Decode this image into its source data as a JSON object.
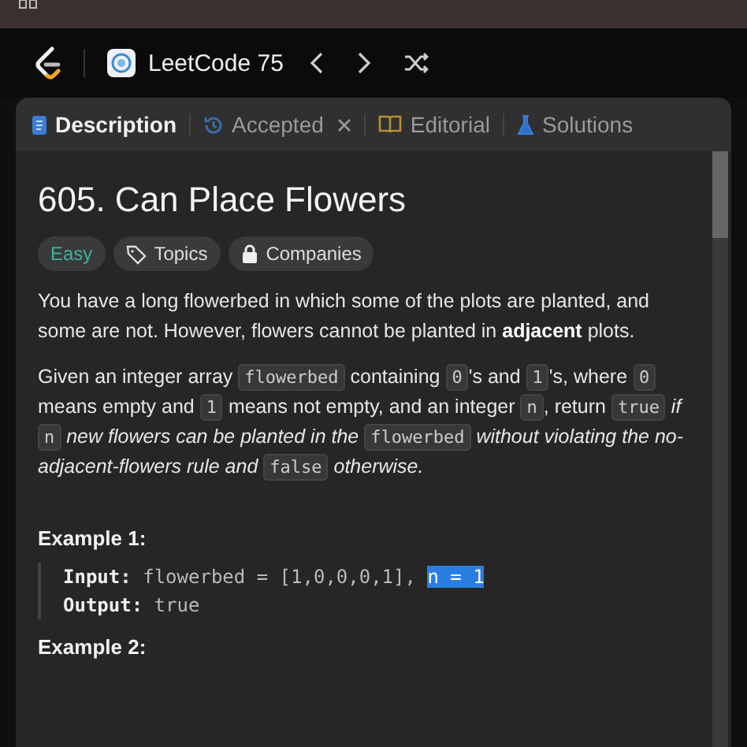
{
  "nav": {
    "list_title": "LeetCode 75"
  },
  "tabs": [
    {
      "label": "Description",
      "selected": true,
      "kind": "doc",
      "closable": false
    },
    {
      "label": "Accepted",
      "selected": false,
      "kind": "history",
      "closable": true
    },
    {
      "label": "Editorial",
      "selected": false,
      "kind": "book",
      "closable": false
    },
    {
      "label": "Solutions",
      "selected": false,
      "kind": "flask",
      "closable": false
    }
  ],
  "problem": {
    "title": "605. Can Place Flowers",
    "tags": [
      {
        "label": "Easy",
        "kind": "difficulty"
      },
      {
        "label": "Topics",
        "kind": "topics"
      },
      {
        "label": "Companies",
        "kind": "companies"
      }
    ],
    "paragraph_1": "You have a long flowerbed in which some of the plots are planted, and some are not. However, flowers cannot be planted in **adjacent** plots.",
    "paragraph_2": [
      {
        "text": "Given an integer array ",
        "kind": "text"
      },
      {
        "text": "flowerbed",
        "kind": "code"
      },
      {
        "text": " containing ",
        "kind": "text"
      },
      {
        "text": "0",
        "kind": "code"
      },
      {
        "text": "'s and ",
        "kind": "text"
      },
      {
        "text": "1",
        "kind": "code"
      },
      {
        "text": "'s, where ",
        "kind": "text"
      },
      {
        "text": "0",
        "kind": "code"
      },
      {
        "text": " means empty and ",
        "kind": "text"
      },
      {
        "text": "1",
        "kind": "code"
      },
      {
        "text": " means not empty, and an integer ",
        "kind": "text"
      },
      {
        "text": "n",
        "kind": "code"
      },
      {
        "text": ", return ",
        "kind": "text"
      },
      {
        "text": "true",
        "kind": "code"
      },
      {
        "text": " if ",
        "kind": "italic"
      },
      {
        "text": "n",
        "kind": "code"
      },
      {
        "text": " new flowers can be planted in the ",
        "kind": "italic"
      },
      {
        "text": "flowerbed",
        "kind": "code"
      },
      {
        "text": " without violating the no-adjacent-flowers rule and ",
        "kind": "italic"
      },
      {
        "text": "false",
        "kind": "code"
      },
      {
        "text": " otherwise.",
        "kind": "italic"
      }
    ],
    "examples": [
      {
        "heading": "Example 1:",
        "input_label": "Input:",
        "input_parts": [
          {
            "text": "flowerbed = [1,0,0,0,1], ",
            "selected": false
          },
          {
            "text": "n = 1",
            "selected": true
          }
        ],
        "output_label": "Output:",
        "output": "true"
      },
      {
        "heading": "Example 2:"
      }
    ]
  }
}
